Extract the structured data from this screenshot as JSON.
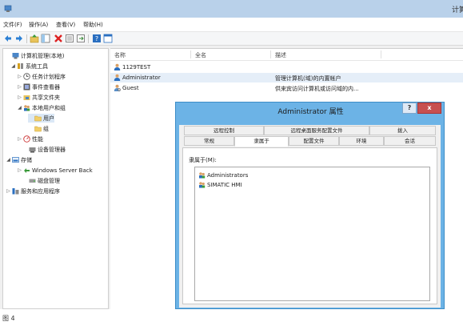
{
  "window": {
    "title_fragment": "计算"
  },
  "menu": [
    "文件(F)",
    "操作(A)",
    "查看(V)",
    "帮助(H)"
  ],
  "toolbar": [
    "back-icon",
    "forward-icon",
    "up-icon",
    "show-hide-tree-icon",
    "delete-icon",
    "properties-icon",
    "export-icon",
    "help-icon",
    "mmc-icon"
  ],
  "tree": {
    "items": [
      {
        "label": "计算机管理(本地)",
        "arrow": "",
        "icon": "computer-management-icon"
      },
      {
        "label": "系统工具",
        "arrow": "◢",
        "icon": "tools-icon"
      },
      {
        "label": "任务计划程序",
        "arrow": "▷",
        "icon": "clock-icon"
      },
      {
        "label": "事件查看器",
        "arrow": "▷",
        "icon": "event-viewer-icon"
      },
      {
        "label": "共享文件夹",
        "arrow": "▷",
        "icon": "shared-folder-icon"
      },
      {
        "label": "本地用户和组",
        "arrow": "◢",
        "icon": "users-icon"
      },
      {
        "label": "用户",
        "arrow": "",
        "icon": "folder-icon"
      },
      {
        "label": "组",
        "arrow": "",
        "icon": "folder-icon"
      },
      {
        "label": "性能",
        "arrow": "▷",
        "icon": "performance-icon"
      },
      {
        "label": "设备管理器",
        "arrow": "",
        "icon": "device-manager-icon"
      },
      {
        "label": "存储",
        "arrow": "◢",
        "icon": "storage-icon"
      },
      {
        "label": "Windows Server Back",
        "arrow": "▷",
        "icon": "backup-icon"
      },
      {
        "label": "磁盘管理",
        "arrow": "",
        "icon": "disk-icon"
      },
      {
        "label": "服务和应用程序",
        "arrow": "▷",
        "icon": "services-icon"
      }
    ]
  },
  "list": {
    "columns": [
      "名称",
      "全名",
      "描述"
    ],
    "rows": [
      {
        "name": "1129TEST",
        "fullname": "",
        "description": ""
      },
      {
        "name": "Administrator",
        "fullname": "",
        "description": "管理计算机(域)的内置帐户"
      },
      {
        "name": "Guest",
        "fullname": "",
        "description": "供来宾访问计算机或访问域的内..."
      }
    ]
  },
  "dialog": {
    "title": "Administrator 属性",
    "help": "?",
    "close": "x",
    "tabs_row1": [
      "远程控制",
      "远程桌面服务配置文件",
      "拨入"
    ],
    "tabs_row2": [
      "常规",
      "隶属于",
      "配置文件",
      "环境",
      "会话"
    ],
    "active_tab": "隶属于",
    "member_label": "隶属于(M):",
    "members": [
      "Administrators",
      "SIMATIC HMI"
    ]
  },
  "caption": "图 4"
}
